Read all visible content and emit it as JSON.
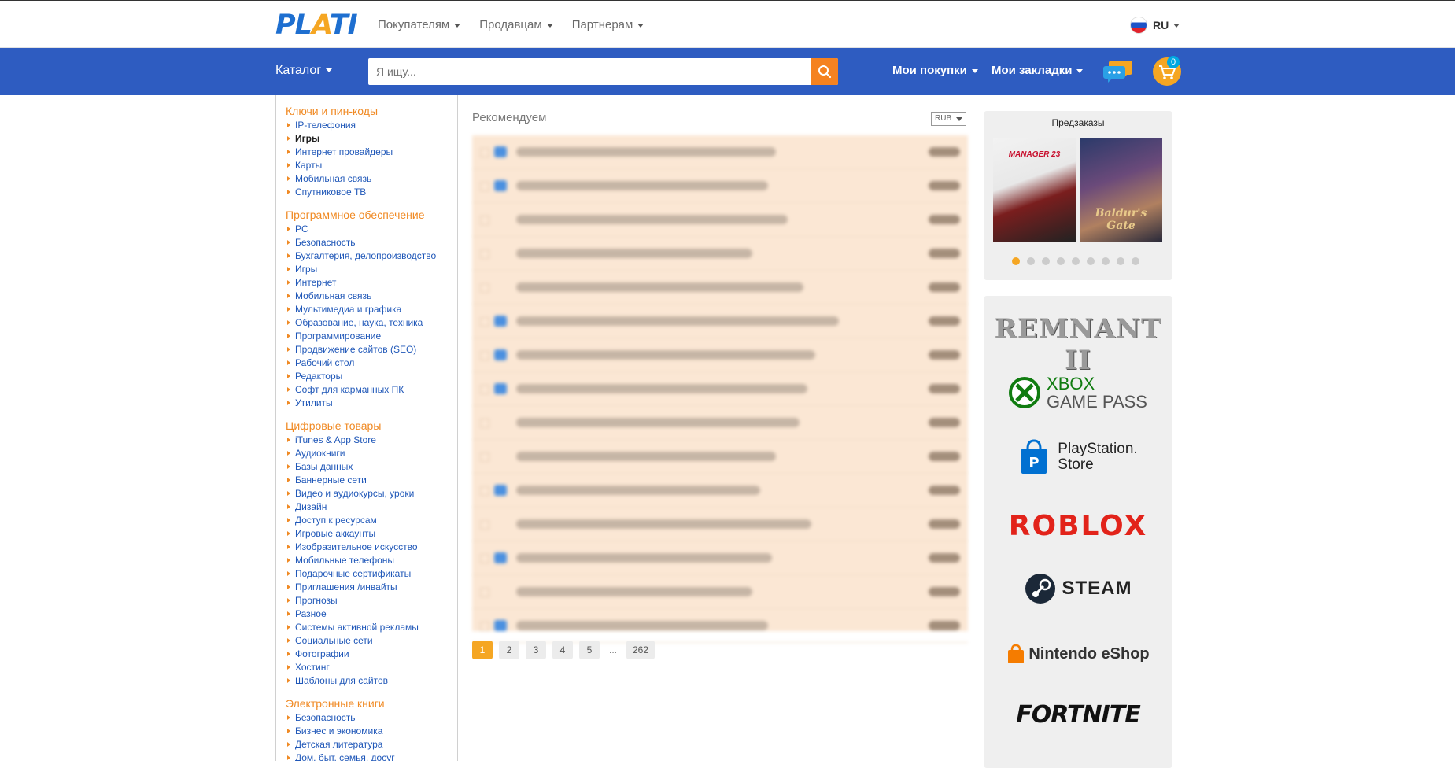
{
  "header": {
    "logo_main": "PL",
    "logo_a": "A",
    "logo_rest": "TI",
    "nav": [
      "Покупателям",
      "Продавцам",
      "Партнерам"
    ],
    "lang": "RU"
  },
  "bar": {
    "catalog": "Каталог",
    "search_placeholder": "Я ищу...",
    "my_purchases": "Мои покупки",
    "my_bookmarks": "Мои закладки",
    "cart_count": "0"
  },
  "sidebar": {
    "groups": [
      {
        "title": "Ключи и пин-коды",
        "items": [
          "IP-телефония",
          "Игры",
          "Интернет провайдеры",
          "Карты",
          "Мобильная связь",
          "Спутниковое ТВ"
        ]
      },
      {
        "title": "Программное обеспечение",
        "items": [
          "PC",
          "Безопасность",
          "Бухгалтерия, делопроизводство",
          "Игры",
          "Интернет",
          "Мобильная связь",
          "Мультимедиа и графика",
          "Образование, наука, техника",
          "Программирование",
          "Продвижение сайтов (SEO)",
          "Рабочий стол",
          "Редакторы",
          "Софт для карманных ПК",
          "Утилиты"
        ]
      },
      {
        "title": "Цифровые товары",
        "items": [
          "iTunes & App Store",
          "Аудиокниги",
          "Базы данных",
          "Баннерные сети",
          "Видео и аудиокурсы, уроки",
          "Дизайн",
          "Доступ к ресурсам",
          "Игровые аккаунты",
          "Изобразительное искусство",
          "Мобильные телефоны",
          "Подарочные сертификаты",
          "Приглашения /инвайты",
          "Прогнозы",
          "Разное",
          "Системы активной рекламы",
          "Социальные сети",
          "Фотографии",
          "Хостинг",
          "Шаблоны для сайтов"
        ]
      },
      {
        "title": "Электронные книги",
        "items": [
          "Безопасность",
          "Бизнес и экономика",
          "Детская литература",
          "Дом, быт, семья, досуг"
        ]
      }
    ]
  },
  "main": {
    "title": "Рекомендуем",
    "currency": "RUB",
    "pages": [
      "1",
      "2",
      "3",
      "4",
      "5"
    ],
    "ellipsis": "...",
    "last_page": "262"
  },
  "right": {
    "preorders": "Предзаказы",
    "cover1": "MANAGER 23",
    "cover2": "Baldur's Gate",
    "brands": [
      "REMNANT II",
      "XBOX",
      "GAME PASS",
      "PlayStation.",
      "Store",
      "ROBLOX",
      "STEAM",
      "Nintendo eShop",
      "FORTNITE"
    ]
  },
  "colors": {
    "accent": "#f5a623",
    "blue": "#2e5cc1",
    "link": "#1f57b8",
    "orange_title": "#f08a24"
  }
}
